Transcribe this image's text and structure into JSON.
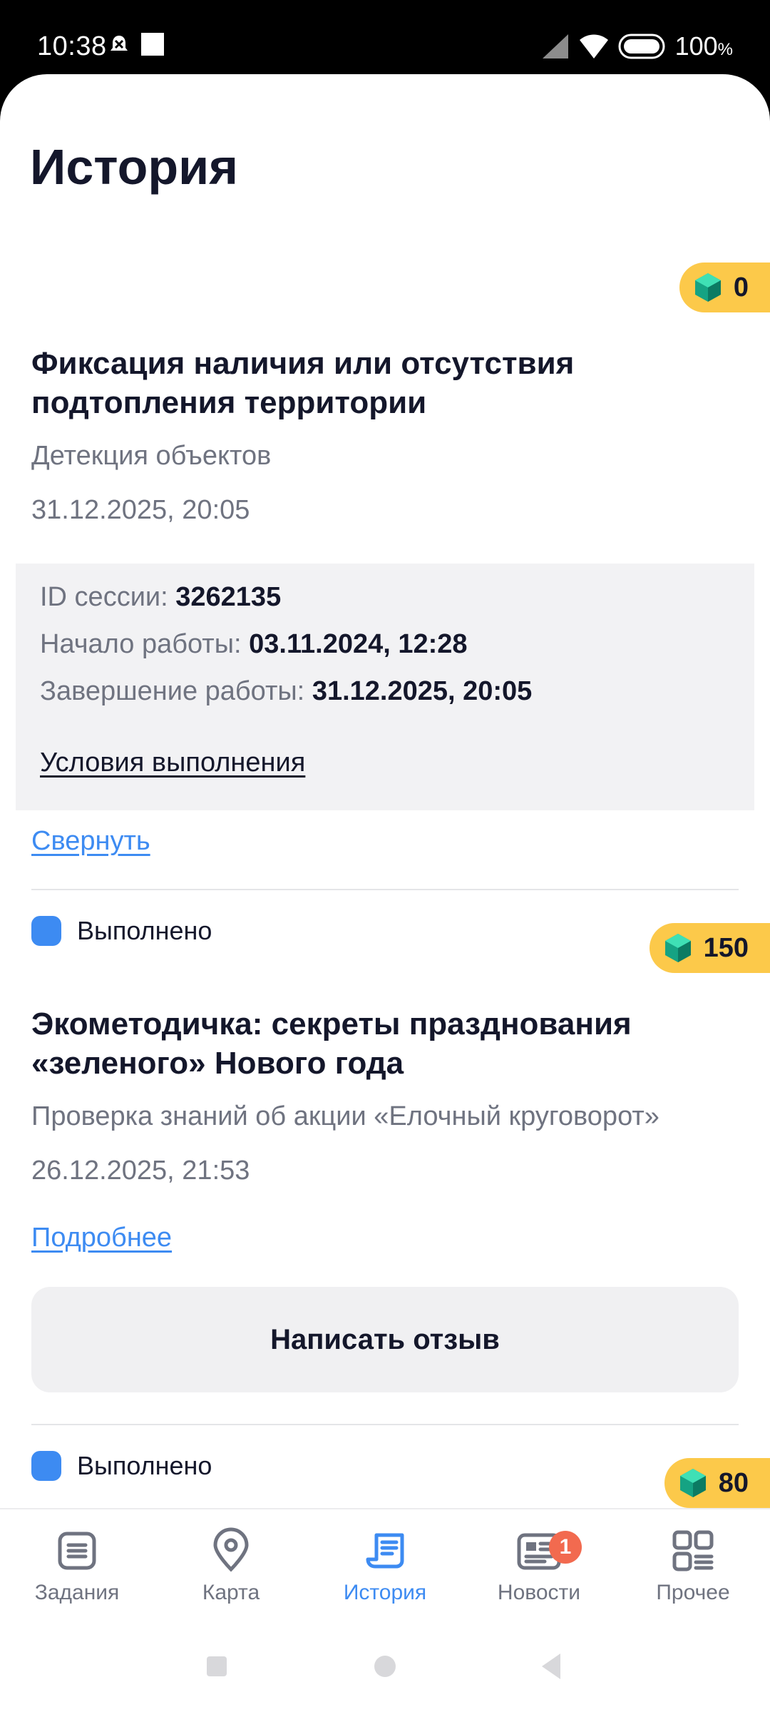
{
  "status_bar": {
    "time": "10:38",
    "battery": "100"
  },
  "page": {
    "title": "История"
  },
  "cards": [
    {
      "coins": "0",
      "title": "Фиксация наличия или отсутствия подтопления территории",
      "subtitle": "Детекция объектов",
      "date": "31.12.2025, 20:05",
      "details": {
        "session_label": "ID сессии:",
        "session_value": "3262135",
        "start_label": "Начало работы:",
        "start_value": "03.11.2024, 12:28",
        "end_label": "Завершение работы:",
        "end_value": "31.12.2025, 20:05",
        "conditions_link": "Условия выполнения"
      },
      "collapse_link": "Свернуть"
    },
    {
      "status": "Выполнено",
      "coins": "150",
      "title": "Экометодичка: секреты празднования «зеленого» Нового года",
      "subtitle": "Проверка знаний об акции «Елочный круговорот»",
      "date": "26.12.2025, 21:53",
      "more_link": "Подробнее",
      "review_button": "Написать отзыв"
    },
    {
      "status": "Выполнено",
      "coins": "80"
    }
  ],
  "bottom_nav": [
    {
      "label": "Задания",
      "icon": "tasks-icon"
    },
    {
      "label": "Карта",
      "icon": "map-pin-icon"
    },
    {
      "label": "История",
      "icon": "history-icon",
      "active": true
    },
    {
      "label": "Новости",
      "icon": "news-icon",
      "badge": "1"
    },
    {
      "label": "Прочее",
      "icon": "grid-icon"
    }
  ],
  "colors": {
    "accent": "#3d8bf2",
    "coin_badge": "#fcc94a",
    "gem": "#1fae8d",
    "notification": "#f26a4f"
  }
}
